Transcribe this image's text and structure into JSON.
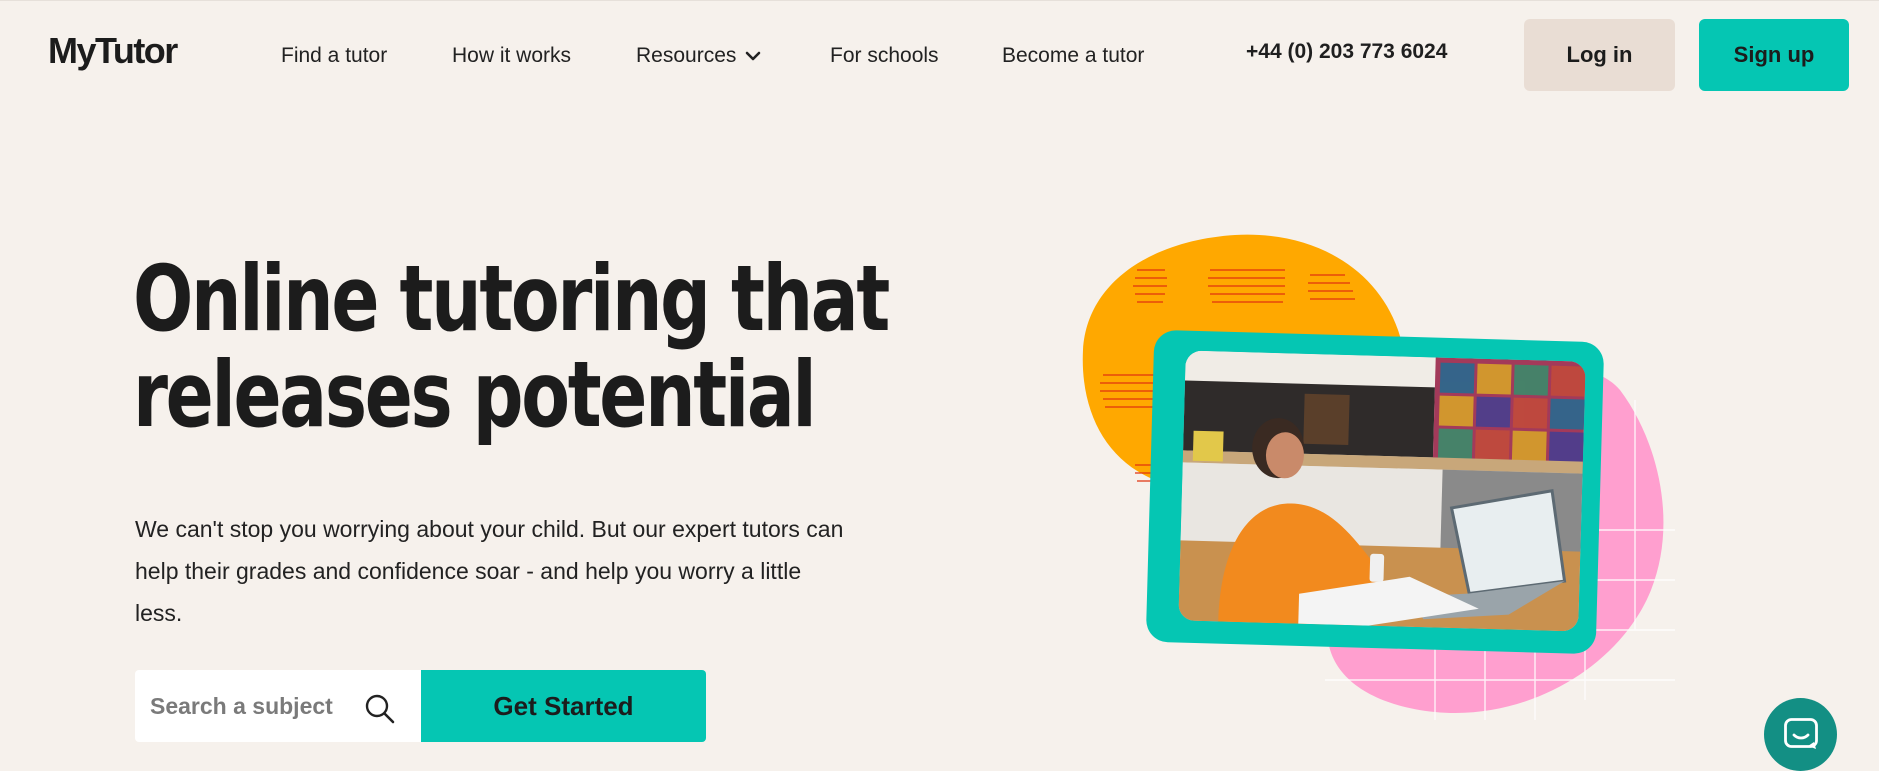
{
  "brand": {
    "logo_text": "MyTutor"
  },
  "nav": {
    "items": [
      {
        "label": "Find a tutor"
      },
      {
        "label": "How it works"
      },
      {
        "label": "Resources"
      },
      {
        "label": "For schools"
      },
      {
        "label": "Become a tutor"
      }
    ],
    "resources_icon": "chevron-down-icon"
  },
  "header": {
    "phone": "+44 (0) 203 773 6024",
    "login_label": "Log in",
    "signup_label": "Sign up"
  },
  "hero": {
    "title_line1": "Online tutoring that",
    "title_line2": "releases potential",
    "subtitle": "We can't stop you worrying about your child. But our expert tutors can help their grades and confidence soar - and help you worry a little less.",
    "search_placeholder": "Search a subject",
    "search_icon": "search-icon",
    "cta_label": "Get Started"
  },
  "colors": {
    "background": "#f6f1ec",
    "accent_teal": "#05c6b3",
    "login_bg": "#e9ddd4",
    "orange_shape": "#ffa800",
    "pink_shape": "#ff9fcf",
    "chat_bg": "#138f84"
  },
  "chat": {
    "icon": "chat-bubble-icon"
  }
}
